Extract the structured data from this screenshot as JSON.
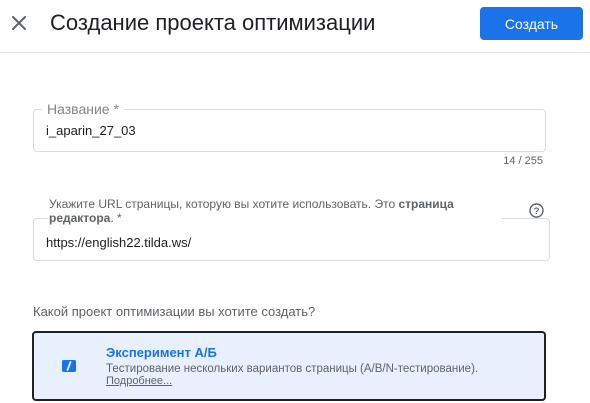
{
  "header": {
    "close_icon": "close-icon",
    "title": "Создание проекта оптимизации",
    "create_label": "Создать"
  },
  "name_field": {
    "label": "Название *",
    "value": "i_aparin_27_03",
    "counter": "14 / 255"
  },
  "url_field": {
    "label_prefix": "Укажите URL страницы, которую вы хотите использовать. Это ",
    "label_bold": "страница редактора",
    "label_suffix": ". *",
    "value": "https://english22.tilda.ws/",
    "help_icon": "help-circle-icon"
  },
  "question": "Какой проект оптимизации вы хотите создать?",
  "option": {
    "title": "Эксперимент А/Б",
    "description": "Тестирование нескольких вариантов страницы (A/B/N-тестирование).",
    "link": "Подробнее...",
    "icon": "ab-test-icon",
    "selected": true
  },
  "colors": {
    "accent": "#1a73e8",
    "selected_bg": "#e8f0fe",
    "border": "#dadce0",
    "text": "#202124",
    "muted": "#5f6368"
  }
}
